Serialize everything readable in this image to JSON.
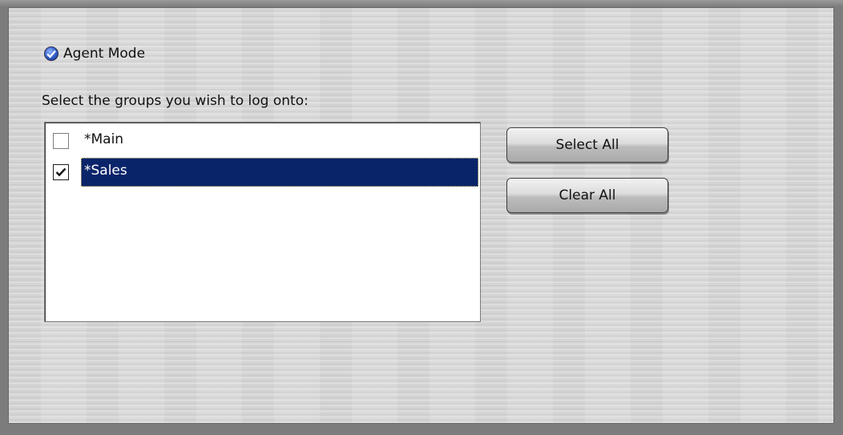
{
  "mode": {
    "label": "Agent Mode",
    "selected": true
  },
  "instructions": "Select the groups you wish to log onto:",
  "groups": [
    {
      "label": "*Main",
      "checked": false,
      "selected": false
    },
    {
      "label": "*Sales",
      "checked": true,
      "selected": true
    }
  ],
  "buttons": {
    "select_all": "Select All",
    "clear_all": "Clear All"
  },
  "colors": {
    "selection_background": "#0a246a",
    "radio_accent": "#2f5fc9"
  }
}
